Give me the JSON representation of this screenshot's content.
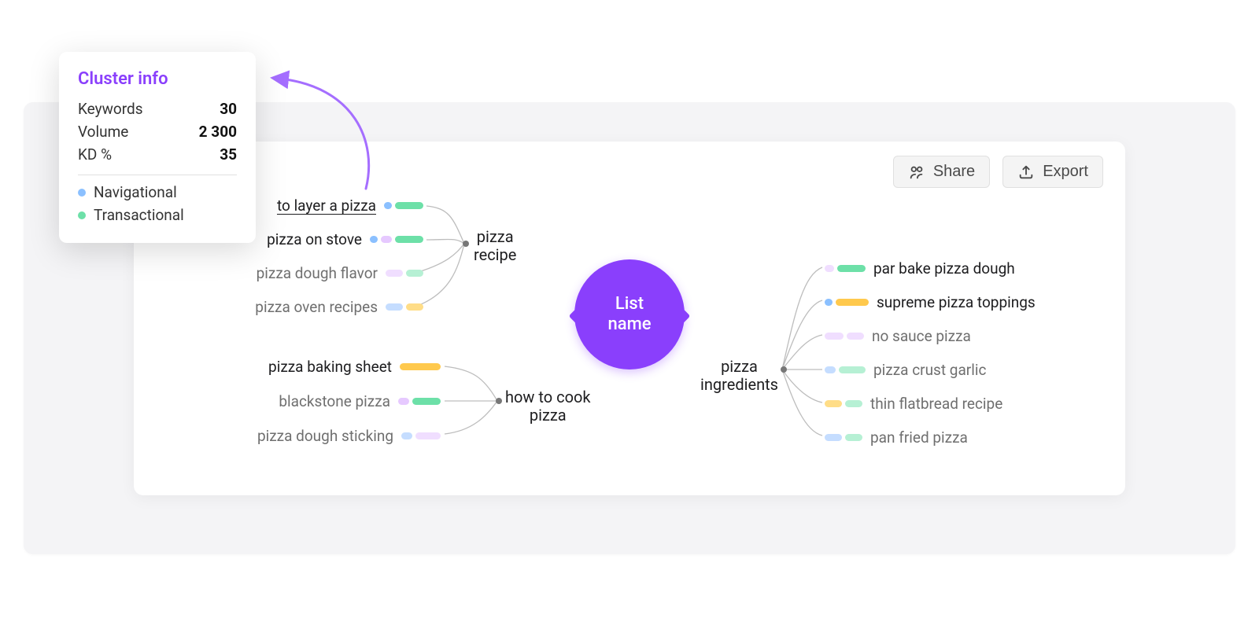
{
  "popover": {
    "title": "Cluster info",
    "rows": [
      {
        "label": "Keywords",
        "value": "30"
      },
      {
        "label": "Volume",
        "value": "2 300"
      },
      {
        "label": "KD %",
        "value": "35"
      }
    ],
    "legend": [
      {
        "label": "Navigational",
        "color_class": "nav"
      },
      {
        "label": "Transactional",
        "color_class": "trans"
      }
    ]
  },
  "toolbar": {
    "share_label": "Share",
    "export_label": "Export"
  },
  "center_label": "List\nname",
  "clusters": {
    "pizza_recipe": {
      "label": "pizza\nrecipe"
    },
    "how_to_cook": {
      "label": "how to cook\npizza"
    },
    "ingredients": {
      "label": "pizza\ningredients"
    }
  },
  "keywords": {
    "left_top": [
      {
        "text": "to layer a pizza",
        "bars": [
          [
            "#8bc0ff",
            10
          ],
          [
            "#6de0a8",
            36
          ]
        ],
        "emph": "hl"
      },
      {
        "text": "pizza on stove",
        "bars": [
          [
            "#8bc0ff",
            10
          ],
          [
            "#e6c9ff",
            14
          ],
          [
            "#6de0a8",
            36
          ]
        ],
        "emph": "norm"
      },
      {
        "text": "pizza dough flavor",
        "bars": [
          [
            "#f0deff",
            22
          ],
          [
            "#b6f0d4",
            22
          ]
        ],
        "emph": "dim"
      },
      {
        "text": "pizza oven recipes",
        "bars": [
          [
            "#c5ddff",
            22
          ],
          [
            "#ffdd87",
            22
          ]
        ],
        "emph": "dim"
      }
    ],
    "left_bot": [
      {
        "text": "pizza baking sheet",
        "bars": [
          [
            "#ffc94d",
            52
          ]
        ],
        "emph": "norm"
      },
      {
        "text": "blackstone pizza",
        "bars": [
          [
            "#e6c9ff",
            14
          ],
          [
            "#6de0a8",
            36
          ]
        ],
        "emph": "dim"
      },
      {
        "text": "pizza dough sticking",
        "bars": [
          [
            "#c5ddff",
            14
          ],
          [
            "#f0deff",
            32
          ]
        ],
        "emph": "dim"
      }
    ],
    "right": [
      {
        "text": "par bake pizza dough",
        "bars": [
          [
            "#f0deff",
            12
          ],
          [
            "#6de0a8",
            36
          ]
        ],
        "emph": "norm"
      },
      {
        "text": "supreme pizza toppings",
        "bars": [
          [
            "#8bc0ff",
            10
          ],
          [
            "#ffc94d",
            42
          ]
        ],
        "emph": "norm"
      },
      {
        "text": "no sauce pizza",
        "bars": [
          [
            "#f0deff",
            24
          ],
          [
            "#f0deff",
            22
          ]
        ],
        "emph": "dim"
      },
      {
        "text": "pizza crust garlic",
        "bars": [
          [
            "#c5ddff",
            14
          ],
          [
            "#b6f0d4",
            34
          ]
        ],
        "emph": "dim"
      },
      {
        "text": "thin flatbread recipe",
        "bars": [
          [
            "#ffdd87",
            22
          ],
          [
            "#b6f0d4",
            22
          ]
        ],
        "emph": "dim"
      },
      {
        "text": "pan fried pizza",
        "bars": [
          [
            "#c5ddff",
            22
          ],
          [
            "#b6f0d4",
            22
          ]
        ],
        "emph": "dim"
      }
    ]
  },
  "colors": {
    "purple": "#8a3ffc",
    "arrow": "#a56eff"
  }
}
